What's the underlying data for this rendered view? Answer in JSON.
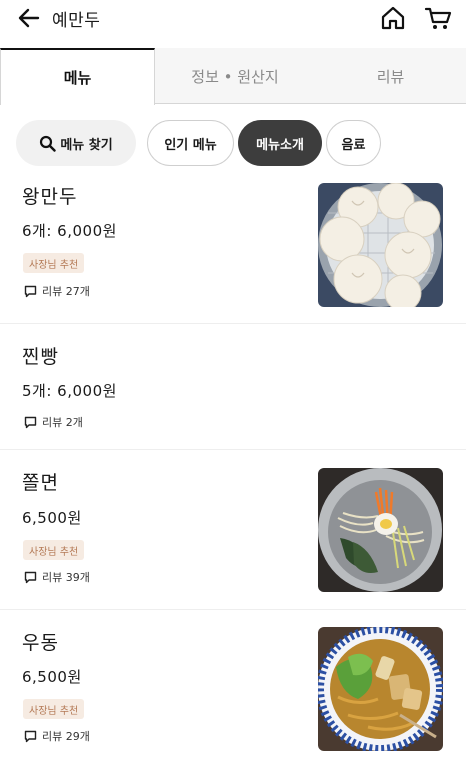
{
  "header": {
    "store_name": "예만두",
    "back_icon": "arrow-left-icon",
    "home_icon": "home-icon",
    "cart_icon": "cart-icon"
  },
  "tabs": [
    {
      "label": "메뉴",
      "active": true
    },
    {
      "label": "정보 • 원산지",
      "active": false
    },
    {
      "label": "리뷰",
      "active": false
    }
  ],
  "chips": {
    "search": "메뉴 찾기",
    "popular": "인기 메뉴",
    "intro": "메뉴소개",
    "drink": "음료"
  },
  "menu_items": [
    {
      "name": "왕만두",
      "price": "6개: 6,000원",
      "badge": "사장님 추천",
      "review": "리뷰 27개",
      "photo": "dumplings"
    },
    {
      "name": "찐빵",
      "price": "5개: 6,000원",
      "badge": "",
      "review": "리뷰 2개",
      "photo": ""
    },
    {
      "name": "쫄면",
      "price": "6,500원",
      "badge": "사장님 추천",
      "review": "리뷰 39개",
      "photo": "jjolmyeon"
    },
    {
      "name": "우동",
      "price": "6,500원",
      "badge": "사장님 추천",
      "review": "리뷰 29개",
      "photo": "udon"
    }
  ],
  "colors": {
    "active_chip_bg": "#3d3d3d",
    "badge_bg": "#f6ebe2",
    "badge_text": "#b47a56"
  }
}
